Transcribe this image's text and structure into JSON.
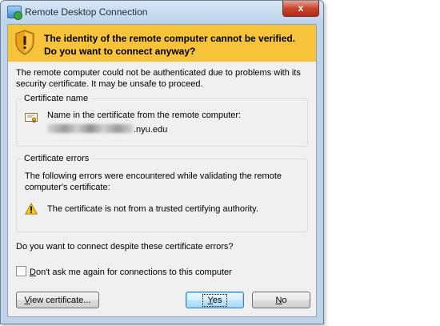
{
  "window": {
    "title": "Remote Desktop Connection",
    "close_label": "x"
  },
  "banner": {
    "text": "The identity of the remote computer cannot be verified. Do you want to connect anyway?",
    "icon": "security-shield-warning-icon",
    "color": "#f7c33b"
  },
  "intro": "The remote computer could not be authenticated due to problems with its security certificate. It may be unsafe to proceed.",
  "certificate_name": {
    "legend": "Certificate name",
    "label": "Name in the certificate from the remote computer:",
    "host_suffix": ".nyu.edu",
    "icon": "certificate-icon"
  },
  "certificate_errors": {
    "legend": "Certificate errors",
    "description": "The following errors were encountered while validating the remote computer's certificate:",
    "items": [
      {
        "icon": "warning-icon",
        "text": "The certificate is not from a trusted certifying authority."
      }
    ]
  },
  "question": "Do you want to connect despite these certificate errors?",
  "dont_ask": {
    "label_underlined": "D",
    "label_rest": "on't ask me again for connections to this computer",
    "checked": false
  },
  "buttons": {
    "view_underlined": "V",
    "view_rest": "iew certificate...",
    "yes_underlined": "Y",
    "yes_rest": "es",
    "no_underlined": "N",
    "no_rest": "o"
  }
}
